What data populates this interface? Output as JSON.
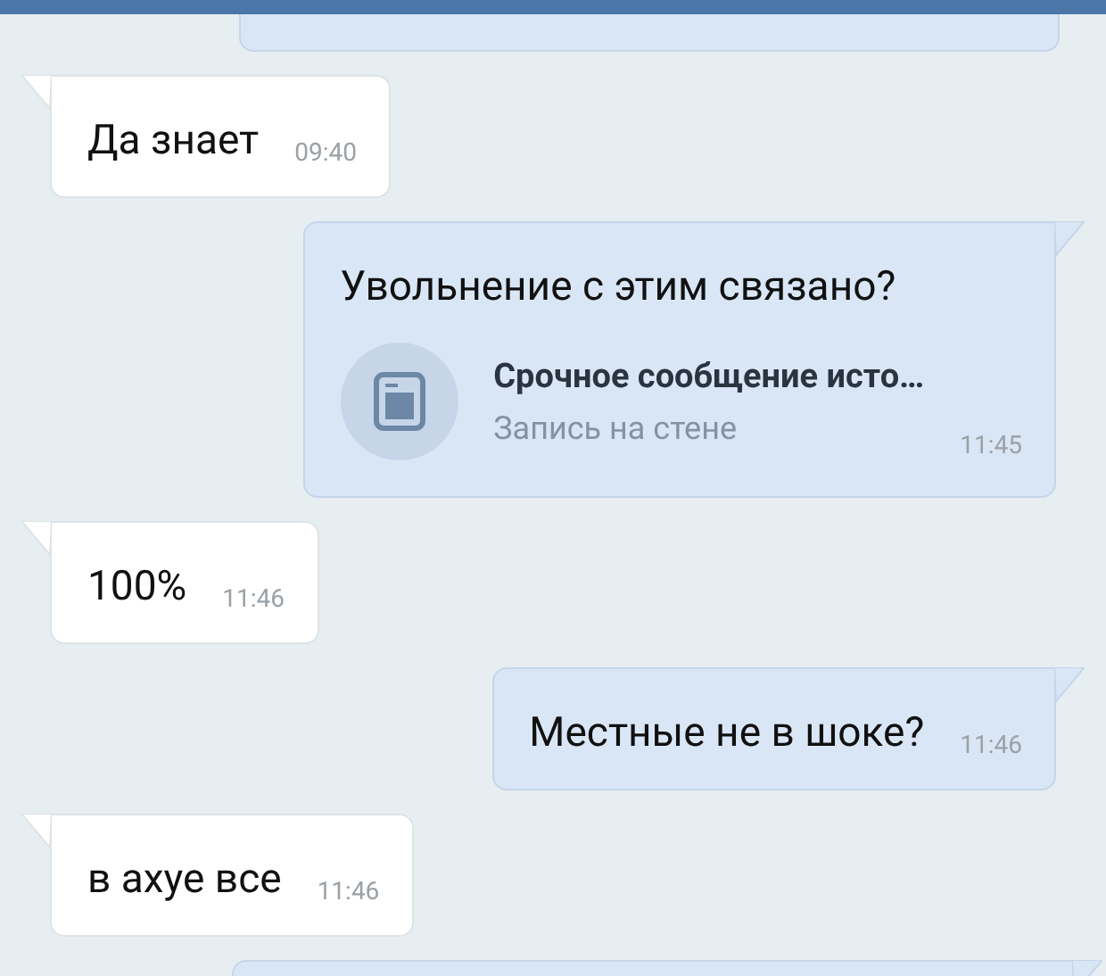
{
  "messages": [
    {
      "kind": "topcut"
    },
    {
      "kind": "incoming",
      "text": "Да знает",
      "time": "09:40"
    },
    {
      "kind": "outgoing",
      "text": "Увольнение с этим связано?",
      "attachment": {
        "title": "Срочное сообщение исто…",
        "subtitle": "Запись на стене"
      },
      "time": "11:45"
    },
    {
      "kind": "incoming",
      "text": "100%",
      "time": "11:46"
    },
    {
      "kind": "outgoing",
      "text": "Местные не в шоке?",
      "time": "11:46"
    },
    {
      "kind": "incoming",
      "text": "в ахуе все",
      "time": "11:46"
    },
    {
      "kind": "bottomcut"
    }
  ]
}
